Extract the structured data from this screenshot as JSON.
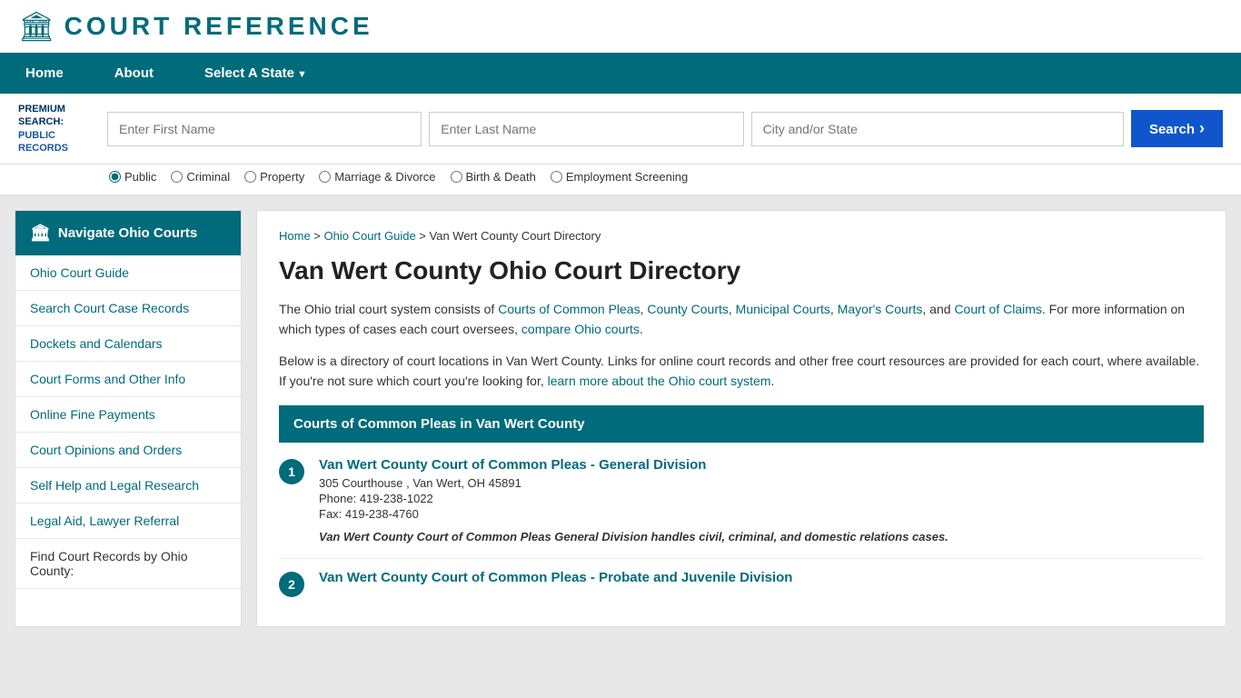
{
  "header": {
    "logo_text": "COURT REFERENCE",
    "logo_icon": "🏛"
  },
  "navbar": {
    "items": [
      {
        "label": "Home",
        "has_arrow": false
      },
      {
        "label": "About",
        "has_arrow": false
      },
      {
        "label": "Select A State",
        "has_arrow": true
      }
    ]
  },
  "search_bar": {
    "premium_line1": "PREMIUM",
    "premium_line2": "SEARCH:",
    "premium_line3": "PUBLIC",
    "premium_line4": "RECORDS",
    "first_name_placeholder": "Enter First Name",
    "last_name_placeholder": "Enter Last Name",
    "city_placeholder": "City and/or State",
    "button_label": "Search"
  },
  "radio_options": [
    {
      "label": "Public",
      "checked": true
    },
    {
      "label": "Criminal",
      "checked": false
    },
    {
      "label": "Property",
      "checked": false
    },
    {
      "label": "Marriage & Divorce",
      "checked": false
    },
    {
      "label": "Birth & Death",
      "checked": false
    },
    {
      "label": "Employment Screening",
      "checked": false
    }
  ],
  "sidebar": {
    "header_label": "Navigate Ohio Courts",
    "items": [
      {
        "label": "Ohio Court Guide"
      },
      {
        "label": "Search Court Case Records"
      },
      {
        "label": "Dockets and Calendars"
      },
      {
        "label": "Court Forms and Other Info"
      },
      {
        "label": "Online Fine Payments"
      },
      {
        "label": "Court Opinions and Orders"
      },
      {
        "label": "Self Help and Legal Research"
      },
      {
        "label": "Legal Aid, Lawyer Referral"
      }
    ],
    "footer_label": "Find Court Records by Ohio County:"
  },
  "breadcrumb": {
    "home": "Home",
    "state": "Ohio Court Guide",
    "current": "Van Wert County Court Directory"
  },
  "content": {
    "page_title": "Van Wert County Ohio Court Directory",
    "intro_text": "The Ohio trial court system consists of ",
    "intro_links": [
      "Courts of Common Pleas",
      "County Courts",
      "Municipal Courts",
      "Mayor's Courts",
      "Court of Claims"
    ],
    "intro_suffix": ". For more information on which types of cases each court oversees, ",
    "intro_compare": "compare Ohio courts",
    "intro_end": ".",
    "body_text": "Below is a directory of court locations in Van Wert County. Links for online court records and other free court resources are provided for each court, where available. If you're not sure which court you're looking for, ",
    "learn_more_link": "learn more about the Ohio court system",
    "body_end": ".",
    "section1_title": "Courts of Common Pleas in Van Wert County",
    "court1": {
      "number": "1",
      "name": "Van Wert County Court of Common Pleas - General Division",
      "address": "305 Courthouse , Van Wert, OH 45891",
      "phone": "Phone: 419-238-1022",
      "fax": "Fax: 419-238-4760",
      "description": "Van Wert County Court of Common Pleas General Division handles civil, criminal, and domestic relations cases."
    },
    "court2": {
      "number": "2",
      "name": "Van Wert County Court of Common Pleas - Probate and Juvenile Division"
    }
  }
}
